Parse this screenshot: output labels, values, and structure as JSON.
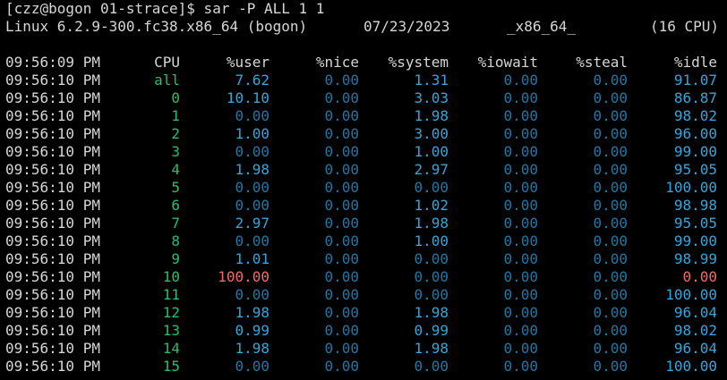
{
  "terminal": {
    "prompt": "[czz@bogon 01-strace]$ sar -P ALL 1 1",
    "system_info": {
      "kernel": "Linux 6.2.9-300.fc38.x86_64 (bogon)",
      "date": "07/23/2023",
      "arch": "_x86_64_",
      "cpu_count": "(16 CPU)"
    }
  },
  "table": {
    "header": {
      "time": "09:56:09 PM",
      "cpu": "CPU",
      "user": "%user",
      "nice": "%nice",
      "system": "%system",
      "iowait": "%iowait",
      "steal": "%steal",
      "idle": "%idle"
    },
    "rows": [
      {
        "time": "09:56:10 PM",
        "cpu": "all",
        "user": "7.62",
        "nice": "0.00",
        "system": "1.31",
        "iowait": "0.00",
        "steal": "0.00",
        "idle": "91.07"
      },
      {
        "time": "09:56:10 PM",
        "cpu": "0",
        "user": "10.10",
        "nice": "0.00",
        "system": "3.03",
        "iowait": "0.00",
        "steal": "0.00",
        "idle": "86.87"
      },
      {
        "time": "09:56:10 PM",
        "cpu": "1",
        "user": "0.00",
        "nice": "0.00",
        "system": "1.98",
        "iowait": "0.00",
        "steal": "0.00",
        "idle": "98.02"
      },
      {
        "time": "09:56:10 PM",
        "cpu": "2",
        "user": "1.00",
        "nice": "0.00",
        "system": "3.00",
        "iowait": "0.00",
        "steal": "0.00",
        "idle": "96.00"
      },
      {
        "time": "09:56:10 PM",
        "cpu": "3",
        "user": "0.00",
        "nice": "0.00",
        "system": "1.00",
        "iowait": "0.00",
        "steal": "0.00",
        "idle": "99.00"
      },
      {
        "time": "09:56:10 PM",
        "cpu": "4",
        "user": "1.98",
        "nice": "0.00",
        "system": "2.97",
        "iowait": "0.00",
        "steal": "0.00",
        "idle": "95.05"
      },
      {
        "time": "09:56:10 PM",
        "cpu": "5",
        "user": "0.00",
        "nice": "0.00",
        "system": "0.00",
        "iowait": "0.00",
        "steal": "0.00",
        "idle": "100.00"
      },
      {
        "time": "09:56:10 PM",
        "cpu": "6",
        "user": "0.00",
        "nice": "0.00",
        "system": "1.02",
        "iowait": "0.00",
        "steal": "0.00",
        "idle": "98.98"
      },
      {
        "time": "09:56:10 PM",
        "cpu": "7",
        "user": "2.97",
        "nice": "0.00",
        "system": "1.98",
        "iowait": "0.00",
        "steal": "0.00",
        "idle": "95.05"
      },
      {
        "time": "09:56:10 PM",
        "cpu": "8",
        "user": "0.00",
        "nice": "0.00",
        "system": "1.00",
        "iowait": "0.00",
        "steal": "0.00",
        "idle": "99.00"
      },
      {
        "time": "09:56:10 PM",
        "cpu": "9",
        "user": "1.01",
        "nice": "0.00",
        "system": "0.00",
        "iowait": "0.00",
        "steal": "0.00",
        "idle": "98.99"
      },
      {
        "time": "09:56:10 PM",
        "cpu": "10",
        "user": "100.00",
        "nice": "0.00",
        "system": "0.00",
        "iowait": "0.00",
        "steal": "0.00",
        "idle": "0.00"
      },
      {
        "time": "09:56:10 PM",
        "cpu": "11",
        "user": "0.00",
        "nice": "0.00",
        "system": "0.00",
        "iowait": "0.00",
        "steal": "0.00",
        "idle": "100.00"
      },
      {
        "time": "09:56:10 PM",
        "cpu": "12",
        "user": "1.98",
        "nice": "0.00",
        "system": "1.98",
        "iowait": "0.00",
        "steal": "0.00",
        "idle": "96.04"
      },
      {
        "time": "09:56:10 PM",
        "cpu": "13",
        "user": "0.99",
        "nice": "0.00",
        "system": "0.99",
        "iowait": "0.00",
        "steal": "0.00",
        "idle": "98.02"
      },
      {
        "time": "09:56:10 PM",
        "cpu": "14",
        "user": "1.98",
        "nice": "0.00",
        "system": "1.98",
        "iowait": "0.00",
        "steal": "0.00",
        "idle": "96.04"
      },
      {
        "time": "09:56:10 PM",
        "cpu": "15",
        "user": "0.00",
        "nice": "0.00",
        "system": "0.00",
        "iowait": "0.00",
        "steal": "0.00",
        "idle": "100.00"
      }
    ]
  },
  "colors": {
    "background": "#000000",
    "text": "#d6d6d6",
    "cpu_id": "#2ebc6c",
    "value_positive": "#31a7dd",
    "value_zero": "#1f78a8",
    "value_hot": "#f26b6b"
  }
}
